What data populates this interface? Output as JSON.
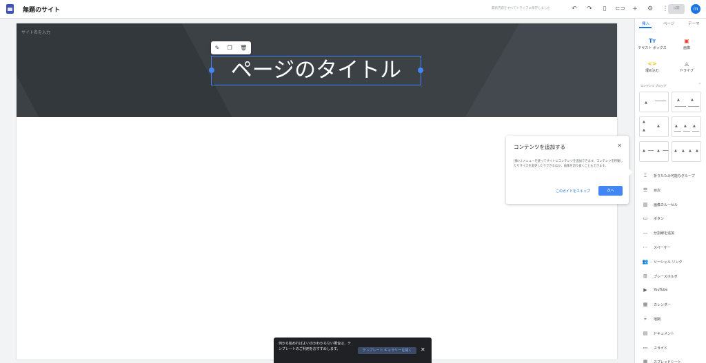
{
  "header": {
    "site_title": "無題のサイト",
    "draft_status": "最新内容をすべてドライブに保存しました",
    "publish_label": "公開",
    "avatar_letter": "m"
  },
  "page": {
    "site_name_placeholder": "サイト名を入力",
    "title": "ページのタイトル"
  },
  "guide": {
    "title": "コンテンツを追加する",
    "body": "[挿入] メニューを使ってサイトにコンテンツを追加できます。コンテンツを移動したりサイズを変更したりできるほか、画像を切り抜くこともできます。",
    "skip_label": "このガイドをスキップ",
    "next_label": "次へ"
  },
  "toast": {
    "message": "何から始めればよいのかわからない場合は、テンプレートのご利用をおすすめします。",
    "action_label": "テンプレート ギャラリーを開く"
  },
  "panel": {
    "tabs": [
      "挿入",
      "ページ",
      "テーマ"
    ],
    "tiles": [
      {
        "label": "テキスト ボックス",
        "icon": "text-box-icon",
        "glyph": "Tт",
        "color": "#1a73e8"
      },
      {
        "label": "画像",
        "icon": "image-icon",
        "glyph": "▣",
        "color": "#ea4335"
      },
      {
        "label": "埋め込む",
        "icon": "embed-icon",
        "glyph": "<>",
        "color": "#fbbc04"
      },
      {
        "label": "ドライブ",
        "icon": "drive-icon",
        "glyph": "◬",
        "color": "#5f6368"
      }
    ],
    "content_blocks_label": "コンテンツ ブロック",
    "items": [
      {
        "label": "折りたたみ可能なグループ",
        "icon": "collapsible-group-icon",
        "glyph": "⌶"
      },
      {
        "label": "目次",
        "icon": "table-of-contents-icon",
        "glyph": "☰"
      },
      {
        "label": "画像カルーセル",
        "icon": "image-carousel-icon",
        "glyph": "▥"
      },
      {
        "label": "ボタン",
        "icon": "button-icon",
        "glyph": "▭"
      },
      {
        "label": "分割線を追加",
        "icon": "divider-icon",
        "glyph": "—"
      },
      {
        "label": "スペーサー",
        "icon": "spacer-icon",
        "glyph": "⋯"
      },
      {
        "label": "ソーシャル リンク",
        "icon": "social-links-icon",
        "glyph": "👥"
      },
      {
        "label": "プレースホルダ",
        "icon": "placeholder-icon",
        "glyph": "⊞"
      },
      {
        "label": "YouTube",
        "icon": "youtube-icon",
        "glyph": "▶"
      },
      {
        "label": "カレンダー",
        "icon": "calendar-icon",
        "glyph": "▦"
      },
      {
        "label": "地図",
        "icon": "map-icon",
        "glyph": "⌖"
      },
      {
        "label": "ドキュメント",
        "icon": "docs-icon",
        "glyph": "▤"
      },
      {
        "label": "スライド",
        "icon": "slides-icon",
        "glyph": "▭"
      },
      {
        "label": "スプレッドシート",
        "icon": "sheets-icon",
        "glyph": "▦"
      }
    ]
  },
  "colors": {
    "accent": "#1a73e8",
    "hero_bg": "#3c4146",
    "selection": "#4285f4"
  }
}
